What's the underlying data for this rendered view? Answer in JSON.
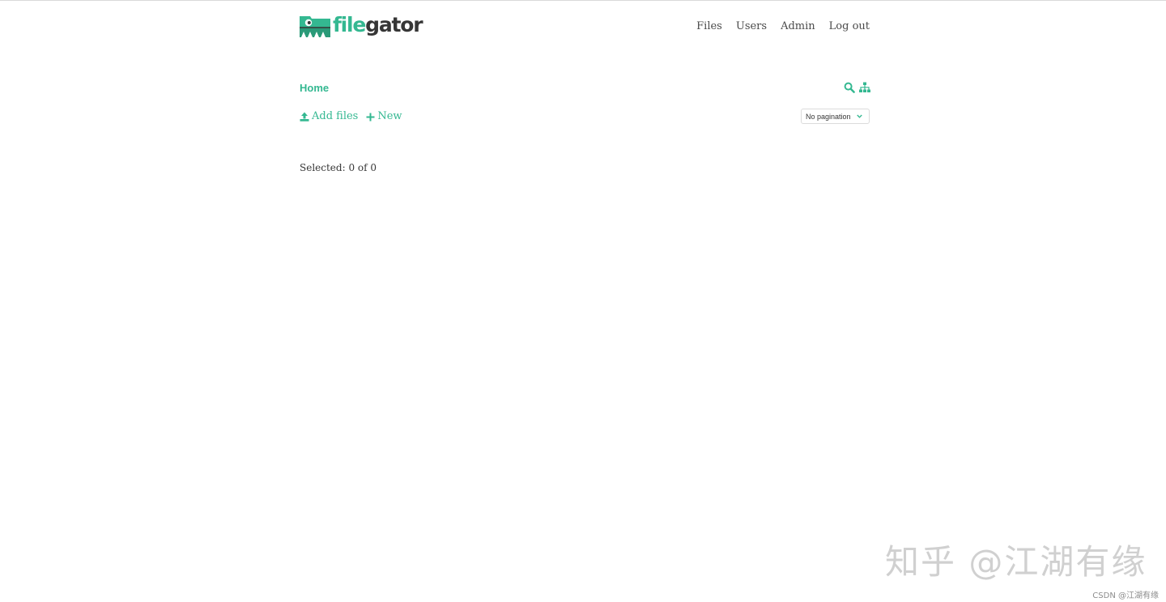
{
  "app": {
    "logo_text_part1": "file",
    "logo_text_part2": "gator",
    "brand_color": "#34b891"
  },
  "nav": {
    "items": [
      "Files",
      "Users",
      "Admin",
      "Log out"
    ]
  },
  "breadcrumb": {
    "home_label": "Home"
  },
  "tools": {
    "search_icon": "search-icon",
    "tree_icon": "sitemap-icon"
  },
  "actions": {
    "add_files_label": "Add files",
    "new_label": "New",
    "add_files_icon": "upload-icon",
    "new_icon": "plus-icon"
  },
  "pagination": {
    "selected": "No pagination"
  },
  "status": {
    "selected_text": "Selected: 0 of 0"
  },
  "watermark": {
    "big": "知乎 @江湖有缘",
    "small": "CSDN @江湖有缘"
  }
}
